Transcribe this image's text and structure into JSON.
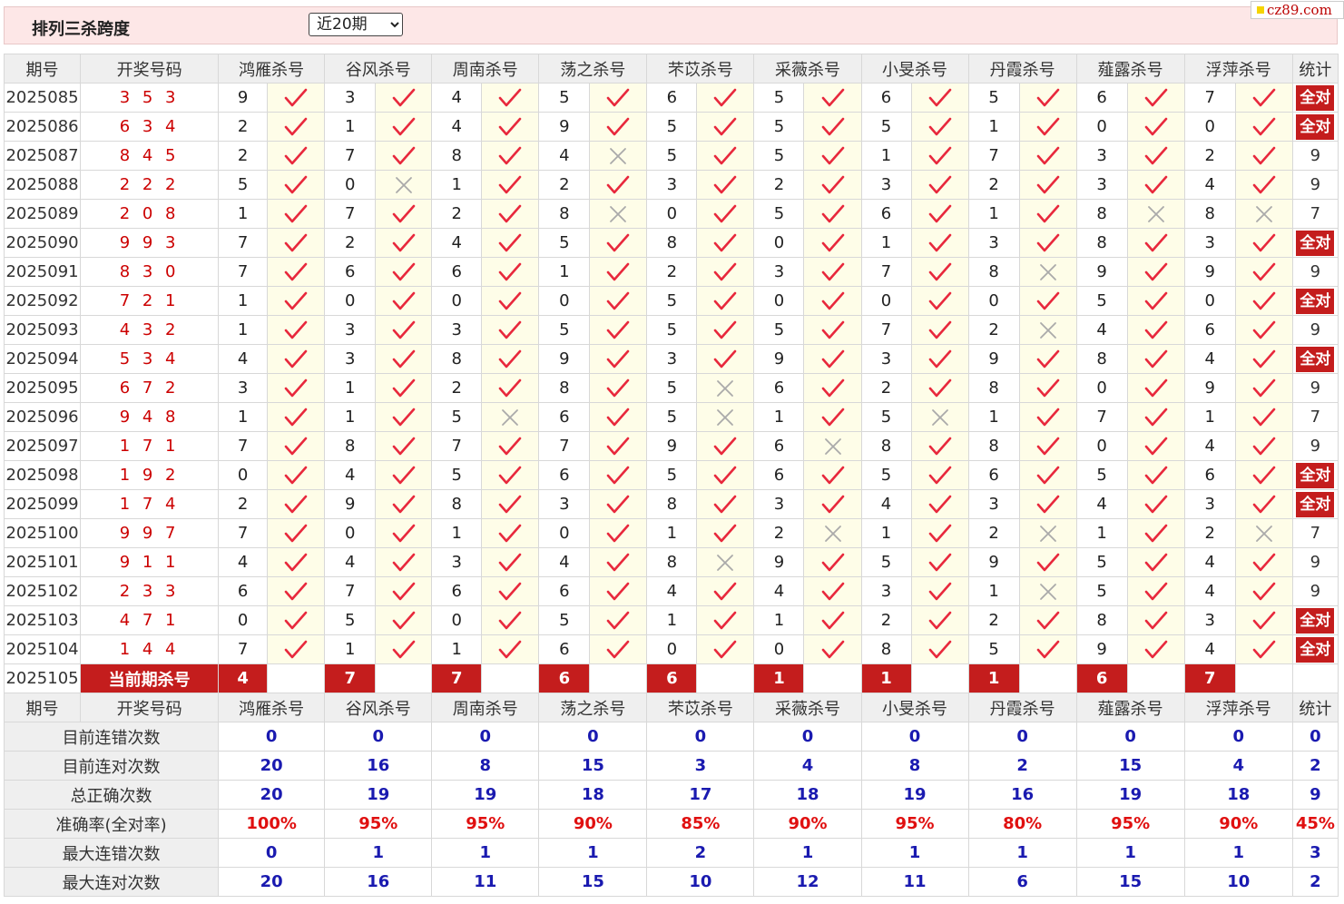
{
  "header": {
    "title": "排列三杀跨度",
    "period_selected": "近20期"
  },
  "logo": {
    "text": "cz89.com"
  },
  "columns": {
    "issue": "期号",
    "draw": "开奖号码",
    "experts": [
      "鸿雁杀号",
      "谷风杀号",
      "周南杀号",
      "荡之杀号",
      "芣苡杀号",
      "采薇杀号",
      "小旻杀号",
      "丹霞杀号",
      "薤露杀号",
      "浮萍杀号"
    ],
    "total": "统计"
  },
  "rows": [
    {
      "issue": "2025085",
      "draw": "3 5 3",
      "kills": [
        "9",
        "3",
        "4",
        "5",
        "6",
        "5",
        "6",
        "5",
        "6",
        "7"
      ],
      "marks": [
        "ok",
        "ok",
        "ok",
        "ok",
        "ok",
        "ok",
        "ok",
        "ok",
        "ok",
        "ok"
      ],
      "total": "全对"
    },
    {
      "issue": "2025086",
      "draw": "6 3 4",
      "kills": [
        "2",
        "1",
        "4",
        "9",
        "5",
        "5",
        "5",
        "1",
        "0",
        "0"
      ],
      "marks": [
        "ok",
        "ok",
        "ok",
        "ok",
        "ok",
        "ok",
        "ok",
        "ok",
        "ok",
        "ok"
      ],
      "total": "全对"
    },
    {
      "issue": "2025087",
      "draw": "8 4 5",
      "kills": [
        "2",
        "7",
        "8",
        "4",
        "5",
        "5",
        "1",
        "7",
        "3",
        "2"
      ],
      "marks": [
        "ok",
        "ok",
        "ok",
        "x",
        "ok",
        "ok",
        "ok",
        "ok",
        "ok",
        "ok"
      ],
      "total": "9"
    },
    {
      "issue": "2025088",
      "draw": "2 2 2",
      "kills": [
        "5",
        "0",
        "1",
        "2",
        "3",
        "2",
        "3",
        "2",
        "3",
        "4"
      ],
      "marks": [
        "ok",
        "x",
        "ok",
        "ok",
        "ok",
        "ok",
        "ok",
        "ok",
        "ok",
        "ok"
      ],
      "total": "9"
    },
    {
      "issue": "2025089",
      "draw": "2 0 8",
      "kills": [
        "1",
        "7",
        "2",
        "8",
        "0",
        "5",
        "6",
        "1",
        "8",
        "8"
      ],
      "marks": [
        "ok",
        "ok",
        "ok",
        "x",
        "ok",
        "ok",
        "ok",
        "ok",
        "x",
        "x"
      ],
      "total": "7"
    },
    {
      "issue": "2025090",
      "draw": "9 9 3",
      "kills": [
        "7",
        "2",
        "4",
        "5",
        "8",
        "0",
        "1",
        "3",
        "8",
        "3"
      ],
      "marks": [
        "ok",
        "ok",
        "ok",
        "ok",
        "ok",
        "ok",
        "ok",
        "ok",
        "ok",
        "ok"
      ],
      "total": "全对"
    },
    {
      "issue": "2025091",
      "draw": "8 3 0",
      "kills": [
        "7",
        "6",
        "6",
        "1",
        "2",
        "3",
        "7",
        "8",
        "9",
        "9"
      ],
      "marks": [
        "ok",
        "ok",
        "ok",
        "ok",
        "ok",
        "ok",
        "ok",
        "x",
        "ok",
        "ok"
      ],
      "total": "9"
    },
    {
      "issue": "2025092",
      "draw": "7 2 1",
      "kills": [
        "1",
        "0",
        "0",
        "0",
        "5",
        "0",
        "0",
        "0",
        "5",
        "0"
      ],
      "marks": [
        "ok",
        "ok",
        "ok",
        "ok",
        "ok",
        "ok",
        "ok",
        "ok",
        "ok",
        "ok"
      ],
      "total": "全对"
    },
    {
      "issue": "2025093",
      "draw": "4 3 2",
      "kills": [
        "1",
        "3",
        "3",
        "5",
        "5",
        "5",
        "7",
        "2",
        "4",
        "6"
      ],
      "marks": [
        "ok",
        "ok",
        "ok",
        "ok",
        "ok",
        "ok",
        "ok",
        "x",
        "ok",
        "ok"
      ],
      "total": "9"
    },
    {
      "issue": "2025094",
      "draw": "5 3 4",
      "kills": [
        "4",
        "3",
        "8",
        "9",
        "3",
        "9",
        "3",
        "9",
        "8",
        "4"
      ],
      "marks": [
        "ok",
        "ok",
        "ok",
        "ok",
        "ok",
        "ok",
        "ok",
        "ok",
        "ok",
        "ok"
      ],
      "total": "全对"
    },
    {
      "issue": "2025095",
      "draw": "6 7 2",
      "kills": [
        "3",
        "1",
        "2",
        "8",
        "5",
        "6",
        "2",
        "8",
        "0",
        "9"
      ],
      "marks": [
        "ok",
        "ok",
        "ok",
        "ok",
        "x",
        "ok",
        "ok",
        "ok",
        "ok",
        "ok"
      ],
      "total": "9"
    },
    {
      "issue": "2025096",
      "draw": "9 4 8",
      "kills": [
        "1",
        "1",
        "5",
        "6",
        "5",
        "1",
        "5",
        "1",
        "7",
        "1"
      ],
      "marks": [
        "ok",
        "ok",
        "x",
        "ok",
        "x",
        "ok",
        "x",
        "ok",
        "ok",
        "ok"
      ],
      "total": "7"
    },
    {
      "issue": "2025097",
      "draw": "1 7 1",
      "kills": [
        "7",
        "8",
        "7",
        "7",
        "9",
        "6",
        "8",
        "8",
        "0",
        "4"
      ],
      "marks": [
        "ok",
        "ok",
        "ok",
        "ok",
        "ok",
        "x",
        "ok",
        "ok",
        "ok",
        "ok"
      ],
      "total": "9"
    },
    {
      "issue": "2025098",
      "draw": "1 9 2",
      "kills": [
        "0",
        "4",
        "5",
        "6",
        "5",
        "6",
        "5",
        "6",
        "5",
        "6"
      ],
      "marks": [
        "ok",
        "ok",
        "ok",
        "ok",
        "ok",
        "ok",
        "ok",
        "ok",
        "ok",
        "ok"
      ],
      "total": "全对"
    },
    {
      "issue": "2025099",
      "draw": "1 7 4",
      "kills": [
        "2",
        "9",
        "8",
        "3",
        "8",
        "3",
        "4",
        "3",
        "4",
        "3"
      ],
      "marks": [
        "ok",
        "ok",
        "ok",
        "ok",
        "ok",
        "ok",
        "ok",
        "ok",
        "ok",
        "ok"
      ],
      "total": "全对"
    },
    {
      "issue": "2025100",
      "draw": "9 9 7",
      "kills": [
        "7",
        "0",
        "1",
        "0",
        "1",
        "2",
        "1",
        "2",
        "1",
        "2"
      ],
      "marks": [
        "ok",
        "ok",
        "ok",
        "ok",
        "ok",
        "x",
        "ok",
        "x",
        "ok",
        "x"
      ],
      "total": "7"
    },
    {
      "issue": "2025101",
      "draw": "9 1 1",
      "kills": [
        "4",
        "4",
        "3",
        "4",
        "8",
        "9",
        "5",
        "9",
        "5",
        "4"
      ],
      "marks": [
        "ok",
        "ok",
        "ok",
        "ok",
        "x",
        "ok",
        "ok",
        "ok",
        "ok",
        "ok"
      ],
      "total": "9"
    },
    {
      "issue": "2025102",
      "draw": "2 3 3",
      "kills": [
        "6",
        "7",
        "6",
        "6",
        "4",
        "4",
        "3",
        "1",
        "5",
        "4"
      ],
      "marks": [
        "ok",
        "ok",
        "ok",
        "ok",
        "ok",
        "ok",
        "ok",
        "x",
        "ok",
        "ok"
      ],
      "total": "9"
    },
    {
      "issue": "2025103",
      "draw": "4 7 1",
      "kills": [
        "0",
        "5",
        "0",
        "5",
        "1",
        "1",
        "2",
        "2",
        "8",
        "3"
      ],
      "marks": [
        "ok",
        "ok",
        "ok",
        "ok",
        "ok",
        "ok",
        "ok",
        "ok",
        "ok",
        "ok"
      ],
      "total": "全对"
    },
    {
      "issue": "2025104",
      "draw": "1 4 4",
      "kills": [
        "7",
        "1",
        "1",
        "6",
        "0",
        "0",
        "8",
        "5",
        "9",
        "4"
      ],
      "marks": [
        "ok",
        "ok",
        "ok",
        "ok",
        "ok",
        "ok",
        "ok",
        "ok",
        "ok",
        "ok"
      ],
      "total": "全对"
    }
  ],
  "current": {
    "issue": "2025105",
    "label": "当前期杀号",
    "kills": [
      "4",
      "7",
      "7",
      "6",
      "6",
      "1",
      "1",
      "1",
      "6",
      "7"
    ]
  },
  "stats": [
    {
      "label": "目前连错次数",
      "values": [
        "0",
        "0",
        "0",
        "0",
        "0",
        "0",
        "0",
        "0",
        "0",
        "0"
      ],
      "total": "0",
      "color": "blue"
    },
    {
      "label": "目前连对次数",
      "values": [
        "20",
        "16",
        "8",
        "15",
        "3",
        "4",
        "8",
        "2",
        "15",
        "4"
      ],
      "total": "2",
      "color": "blue"
    },
    {
      "label": "总正确次数",
      "values": [
        "20",
        "19",
        "19",
        "18",
        "17",
        "18",
        "19",
        "16",
        "19",
        "18"
      ],
      "total": "9",
      "color": "blue"
    },
    {
      "label": "准确率(全对率)",
      "values": [
        "100%",
        "95%",
        "95%",
        "90%",
        "85%",
        "90%",
        "95%",
        "80%",
        "95%",
        "90%"
      ],
      "total": "45%",
      "color": "red"
    },
    {
      "label": "最大连错次数",
      "values": [
        "0",
        "1",
        "1",
        "1",
        "2",
        "1",
        "1",
        "1",
        "1",
        "1"
      ],
      "total": "3",
      "color": "blue"
    },
    {
      "label": "最大连对次数",
      "values": [
        "20",
        "16",
        "11",
        "15",
        "10",
        "12",
        "11",
        "6",
        "15",
        "10"
      ],
      "total": "2",
      "color": "blue"
    }
  ],
  "colors": {
    "tick": "#e8283c",
    "cross": "#aaaaaa",
    "badge": "#c41d1d",
    "stat_blue": "#1a1ab0",
    "stat_red": "#e01010"
  },
  "icons": {
    "ok": "check-icon",
    "x": "cross-icon"
  }
}
